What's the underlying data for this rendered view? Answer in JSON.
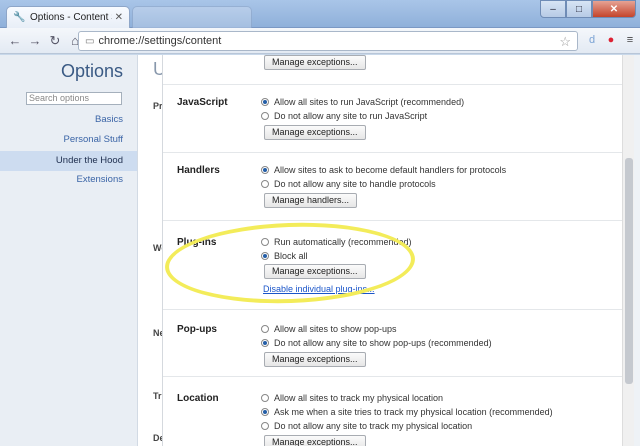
{
  "window": {
    "tab_title": "Options - Content Settings",
    "tab_icon": "wrench-icon",
    "controls": [
      "–",
      "□",
      "✕"
    ]
  },
  "toolbar": {
    "url": "chrome://settings/content",
    "back_glyph": "←",
    "forward_glyph": "→",
    "reload_glyph": "↻",
    "home_glyph": "⌂",
    "star_glyph": "☆",
    "ext_glyphs": [
      "d",
      "●",
      "≡"
    ]
  },
  "leftnav": {
    "title": "Options",
    "search_placeholder": "Search options",
    "items": [
      "Basics",
      "Personal Stuff",
      "Under the Hood",
      "Extensions"
    ],
    "active_index": 2
  },
  "behind": {
    "U": "U",
    "letters": [
      "Pri",
      "We",
      "Ne",
      "Tr",
      "De"
    ]
  },
  "dialog": {
    "top_button": "Manage exceptions...",
    "sections": [
      {
        "label": "JavaScript",
        "options": [
          {
            "text": "Allow all sites to run JavaScript (recommended)",
            "checked": true
          },
          {
            "text": "Do not allow any site to run JavaScript",
            "checked": false
          }
        ],
        "button": "Manage exceptions..."
      },
      {
        "label": "Handlers",
        "options": [
          {
            "text": "Allow sites to ask to become default handlers for protocols",
            "checked": true
          },
          {
            "text": "Do not allow any site to handle protocols",
            "checked": false
          }
        ],
        "button": "Manage handlers..."
      },
      {
        "label": "Plug-ins",
        "options": [
          {
            "text": "Run automatically (recommended)",
            "checked": false
          },
          {
            "text": "Block all",
            "checked": true
          }
        ],
        "button": "Manage exceptions...",
        "link": "Disable individual plug-ins..."
      },
      {
        "label": "Pop-ups",
        "options": [
          {
            "text": "Allow all sites to show pop-ups",
            "checked": false
          },
          {
            "text": "Do not allow any site to show pop-ups (recommended)",
            "checked": true
          }
        ],
        "button": "Manage exceptions..."
      },
      {
        "label": "Location",
        "options": [
          {
            "text": "Allow all sites to track my physical location",
            "checked": false
          },
          {
            "text": "Ask me when a site tries to track my physical location (recommended)",
            "checked": true
          },
          {
            "text": "Do not allow any site to track my physical location",
            "checked": false
          }
        ],
        "button": "Manage exceptions..."
      }
    ]
  },
  "colors": {
    "highlight": "#f3ec5a",
    "link": "#1a55c9",
    "nav_active": "#cddcf0"
  }
}
